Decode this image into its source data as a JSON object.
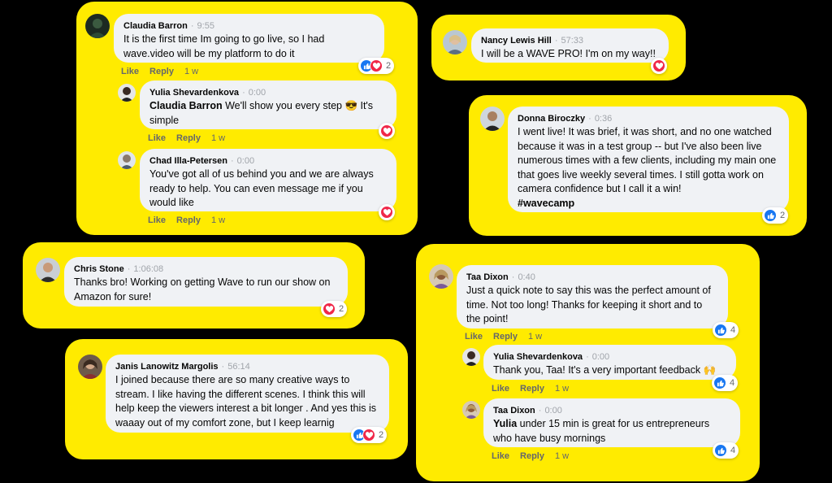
{
  "colors": {
    "card": "#ffeb00",
    "bubble": "#f0f2f5",
    "like": "#1877f2",
    "love": "#f02849",
    "meta": "#65676b"
  },
  "labels": {
    "like": "Like",
    "reply": "Reply"
  },
  "comments": {
    "c1": {
      "name": "Claudia Barron",
      "time": "9:55",
      "text": "It is the first time Im going to go live, so I had wave.video will be my platform to do it",
      "ago": "1 w",
      "reaction_count": "2"
    },
    "c2": {
      "name": "Yulia Shevardenkova",
      "time": "0:00",
      "mention": "Claudia Barron",
      "text": " We'll show you every step 😎 It's simple",
      "ago": "1 w"
    },
    "c3": {
      "name": "Chad Illa-Petersen",
      "time": "0:00",
      "text": "You've got all of us behind you and we are always ready to help. You can even message me if you would like",
      "ago": "1 w"
    },
    "c4": {
      "name": "Nancy Lewis Hill",
      "time": "57:33",
      "text": "I will be a WAVE PRO! I'm on my way!!"
    },
    "c5": {
      "name": "Donna Biroczky",
      "time": "0:36",
      "text": "I went live! It was brief, it was short, and no one watched because it was in a test group -- but I've also been live numerous times with a few clients, including my main one that goes live weekly several times. I still gotta work on camera confidence but I call it a win!",
      "hashtag": "#wavecamp",
      "reaction_count": "2"
    },
    "c6": {
      "name": "Chris Stone",
      "time": "1:06:08",
      "text": "Thanks bro! Working on getting Wave to run our show on Amazon for sure!",
      "reaction_count": "2"
    },
    "c7": {
      "name": "Janis Lanowitz Margolis",
      "time": "56:14",
      "text": "I joined because there are so many creative ways to stream. I like having the different scenes. I think this will help keep the viewers interest a bit longer . And yes this is waaay out of my comfort zone, but I keep learnig",
      "reaction_count": "2"
    },
    "c8": {
      "name": "Taa Dixon",
      "time": "0:40",
      "text": "Just a quick note to say this was the perfect amount of time. Not too long! Thanks for keeping it short and to the point!",
      "ago": "1 w",
      "reaction_count": "4"
    },
    "c9": {
      "name": "Yulia Shevardenkova",
      "time": "0:00",
      "text": "Thank you, Taa! It's a very important feedback 🙌",
      "ago": "1 w",
      "reaction_count": "4"
    },
    "c10": {
      "name": "Taa Dixon",
      "time": "0:00",
      "mention": "Yulia",
      "text": " under 15 min is great for us entrepreneurs who have busy mornings",
      "ago": "1 w",
      "reaction_count": "4"
    }
  }
}
